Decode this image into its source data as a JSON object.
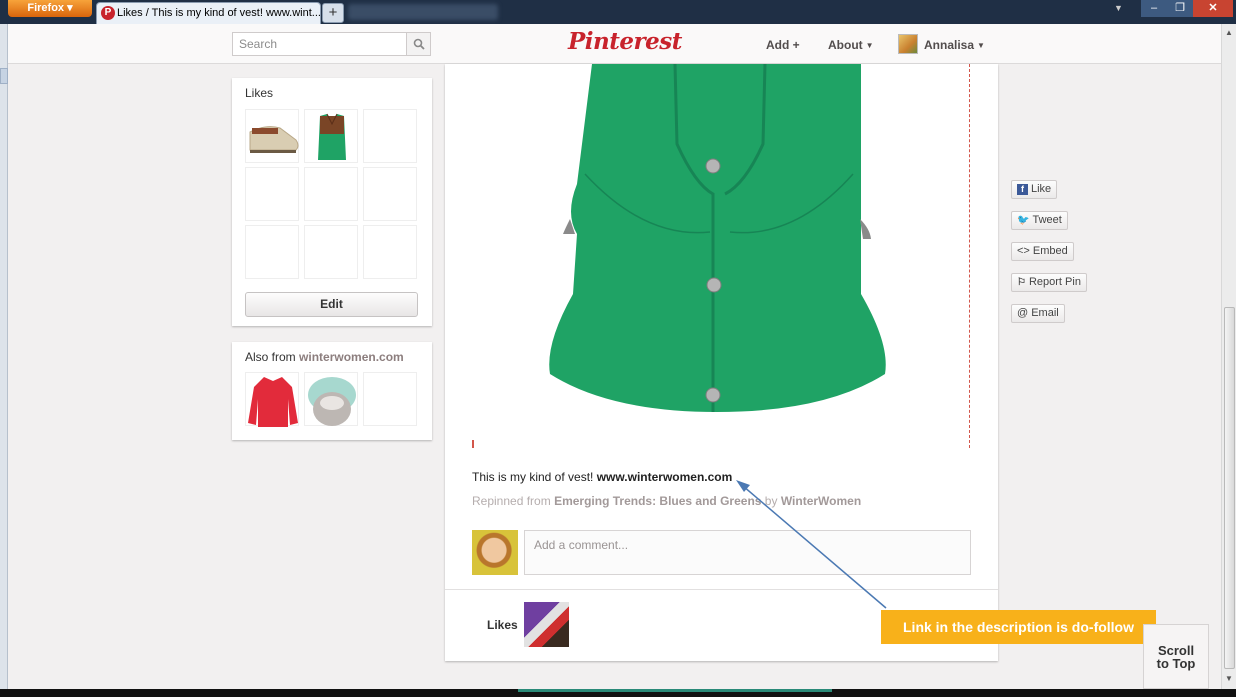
{
  "browser": {
    "menu_label": "Firefox",
    "tab_title": "Likes / This is my kind of vest! www.wint...",
    "new_tab": "+",
    "min": "–",
    "max": "❐",
    "close": "✕",
    "dropdown": "▼"
  },
  "header": {
    "search_placeholder": "Search",
    "logo": "Pinterest",
    "nav": {
      "add": "Add",
      "add_icon": "+",
      "about": "About",
      "user": "Annalisa"
    }
  },
  "likes_box": {
    "title": "Likes",
    "edit_label": "Edit"
  },
  "also_box": {
    "title_prefix": "Also from",
    "source": "winterwomen.com"
  },
  "pin": {
    "description_text": "This is my kind of vest!",
    "description_link": "www.winterwomen.com",
    "repinned_prefix": "Repinned from",
    "board": "Emerging Trends: Blues and Greens",
    "by": "by",
    "repinner": "WinterWomen",
    "comment_placeholder": "Add a comment...",
    "likes_label": "Likes",
    "vest_color": "#1fa365"
  },
  "share": {
    "like": "Like",
    "tweet": "Tweet",
    "embed": "<> Embed",
    "report": "Report Pin",
    "email": "@ Email"
  },
  "annotation": {
    "text": "Link in the description is do-follow",
    "color": "#f8b11a"
  },
  "scroll_top": {
    "line1": "Scroll",
    "line2": "to Top"
  }
}
